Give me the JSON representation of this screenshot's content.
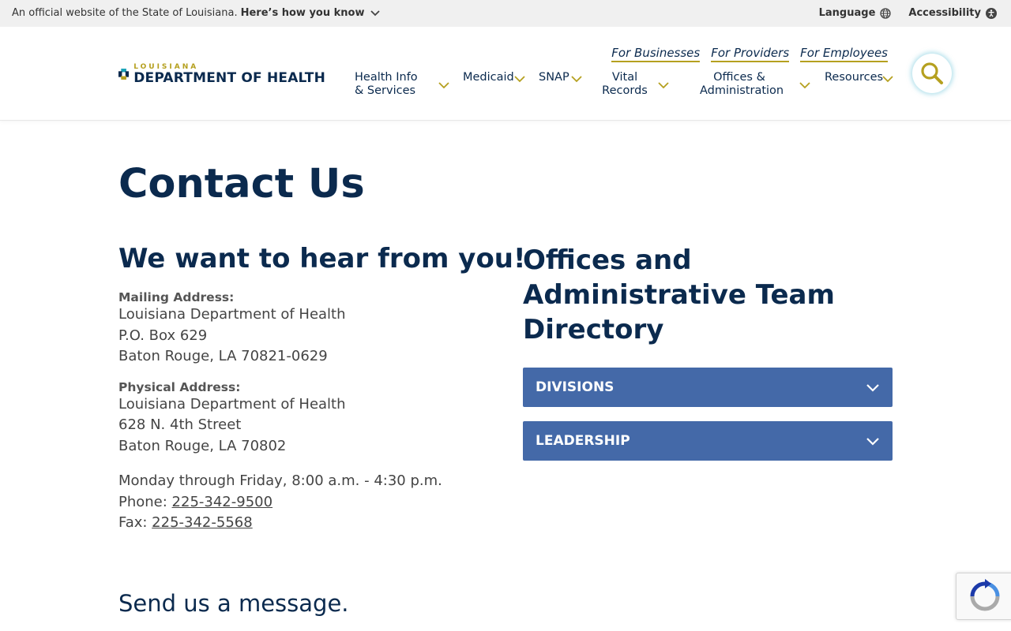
{
  "banner": {
    "official_text": "An official website of the State of Louisiana.",
    "how_text": "Here’s how you know",
    "language": "Language",
    "accessibility": "Accessibility"
  },
  "logo": {
    "small": "LOUISIANA",
    "big": "DEPARTMENT OF HEALTH",
    "colors": [
      "#0b2a4e",
      "#b5a01f",
      "#1aa3b8"
    ]
  },
  "audience_links": [
    "For Businesses",
    "For Providers",
    "For Employees"
  ],
  "nav": {
    "health": [
      "Health Info",
      "& Services"
    ],
    "medicaid": "Medicaid",
    "snap": "SNAP",
    "vital": [
      "Vital",
      "Records"
    ],
    "offices": [
      "Offices &",
      "Administration"
    ],
    "resources": "Resources"
  },
  "page_title": "Contact Us",
  "left": {
    "heading": "We want to hear from you!",
    "mailing_label": "Mailing Address:",
    "mailing_lines": [
      "Louisiana Department of Health",
      "P.O. Box 629",
      "Baton Rouge, LA 70821-0629"
    ],
    "physical_label": "Physical Address:",
    "physical_lines": [
      "Louisiana Department of Health",
      "628 N. 4th Street",
      "Baton Rouge, LA 70802"
    ],
    "hours": "Monday through Friday, 8:00 a.m. - 4:30 p.m.",
    "phone_label": "Phone: ",
    "phone": "225-342-9500",
    "fax_label": "Fax: ",
    "fax": "225-342-5568",
    "send_message": "Send us a message."
  },
  "right": {
    "heading": "Offices and Administrative Team Directory",
    "accordions": [
      "DIVISIONS",
      "LEADERSHIP"
    ]
  },
  "colors": {
    "navy": "#0b2a4e",
    "gold": "#b5a01f",
    "accordion_blue": "#4469a8"
  }
}
